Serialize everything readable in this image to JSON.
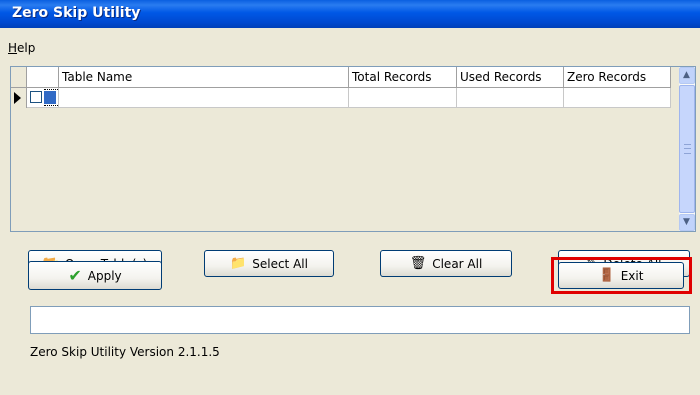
{
  "window": {
    "title": "Zero Skip Utility"
  },
  "menu": {
    "help_prefix": "H",
    "help_rest": "elp"
  },
  "grid": {
    "columns": [
      "Table Name",
      "Total Records",
      "Used Records",
      "Zero Records"
    ],
    "rows": [
      {
        "checked": false,
        "table_name": "",
        "total_records": "",
        "used_records": "",
        "zero_records": ""
      }
    ]
  },
  "buttons": {
    "open_tables": "Open Table(s)",
    "select_all": "Select All",
    "clear_all": "Clear All",
    "delete_all": "Delete All",
    "apply": "Apply",
    "exit": "Exit"
  },
  "icons": {
    "open_tables": "folder-open-icon",
    "select_all": "folders-icon",
    "clear_all": "clear-icon",
    "delete_all": "eraser-icon",
    "apply": "checkmark-icon",
    "exit": "exit-door-icon"
  },
  "colors": {
    "title_bar": "#0054e3",
    "highlight_box": "#e00000",
    "apply_check": "#2ca02c"
  },
  "output_box": {
    "value": ""
  },
  "status": {
    "version_text": "Zero Skip Utility Version  2.1.1.5"
  }
}
